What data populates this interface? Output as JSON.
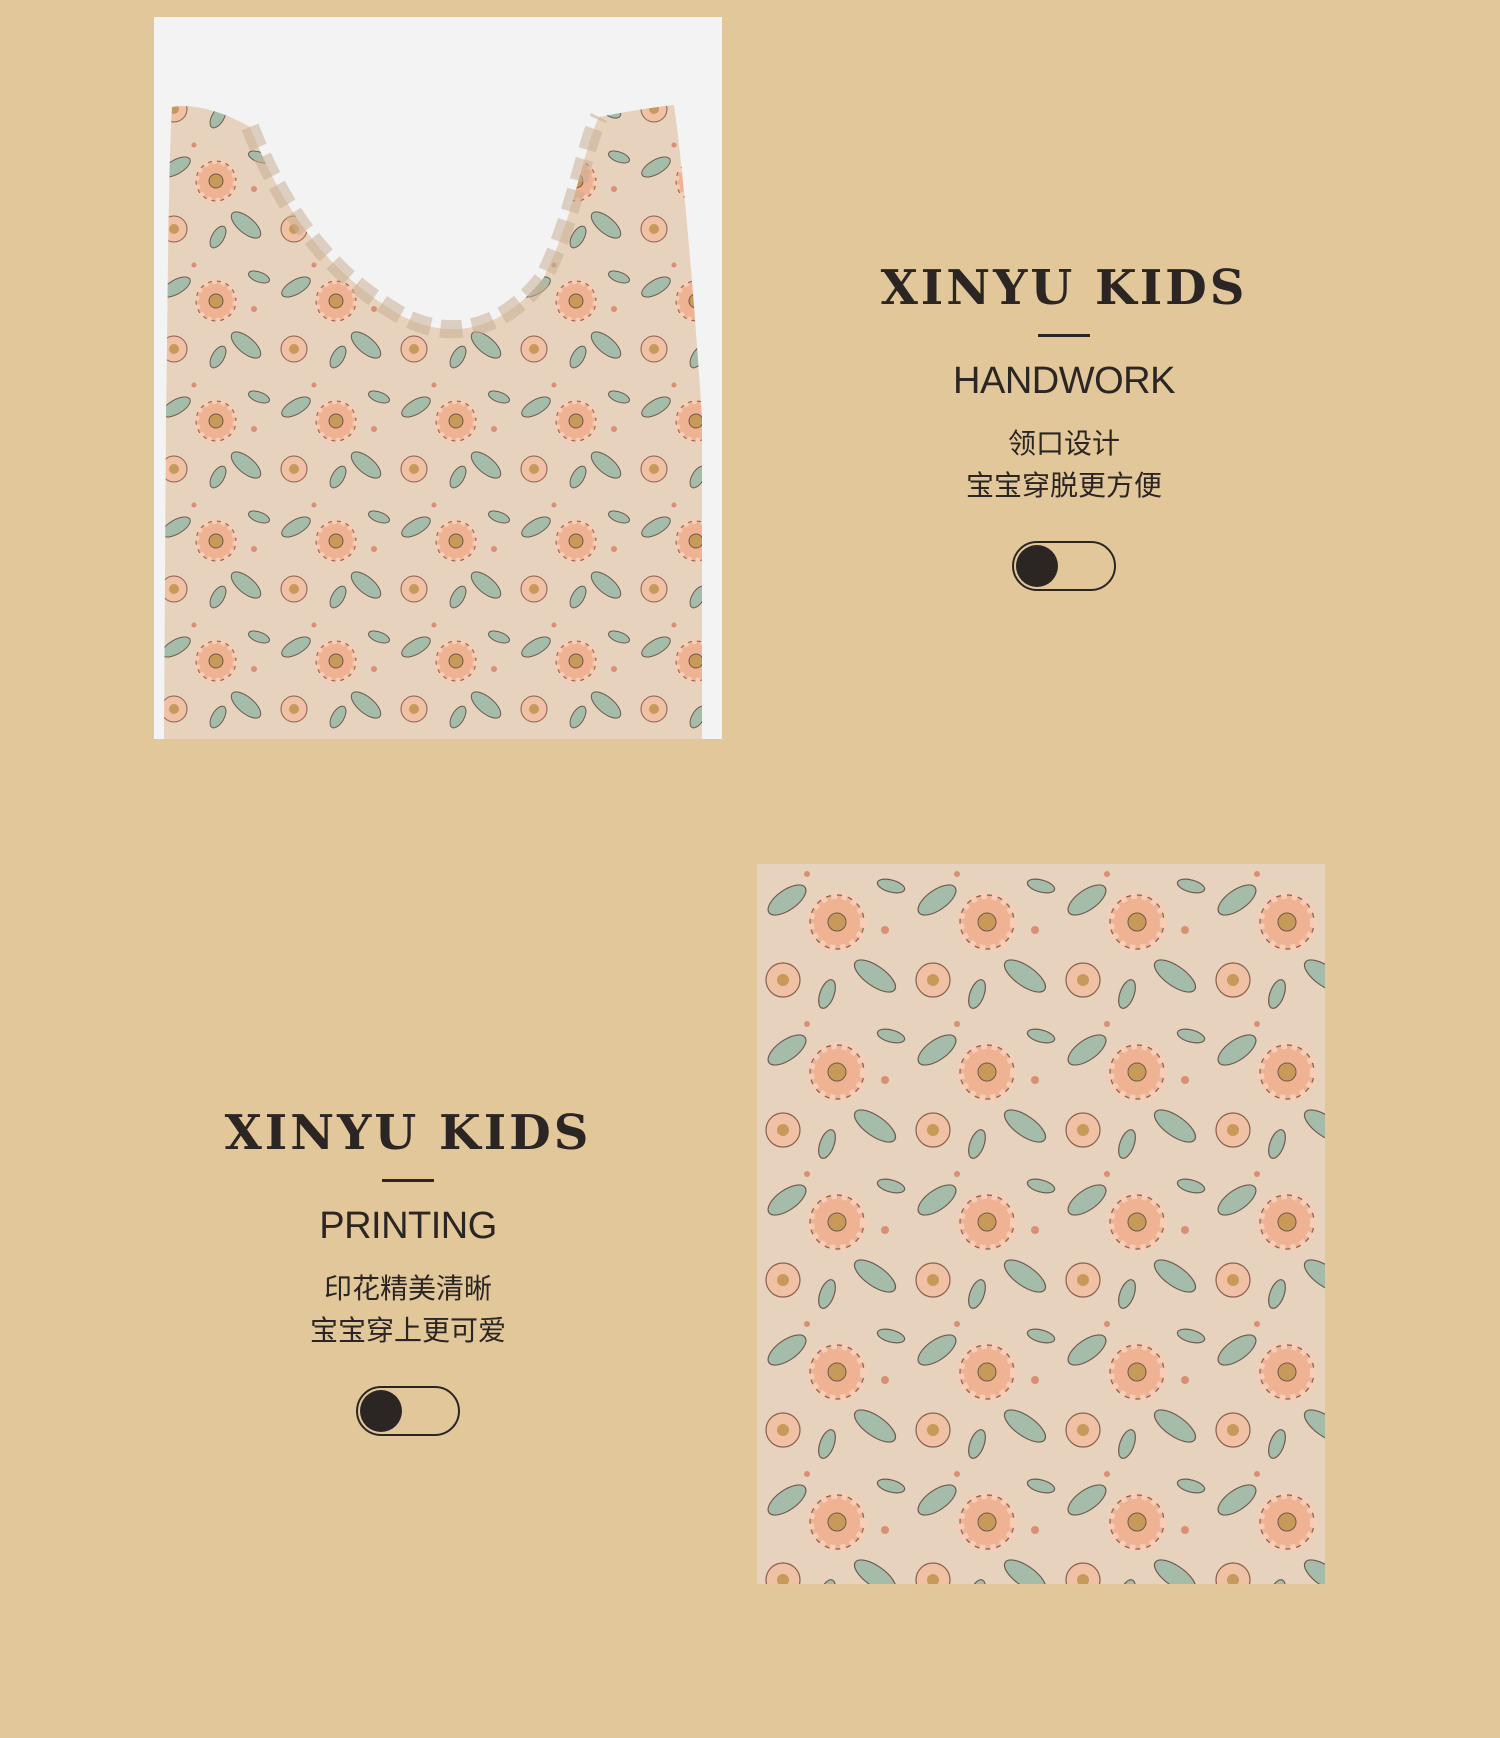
{
  "colors": {
    "background": "#e2c79b",
    "ink": "#2b2623",
    "fabric": "#e6d2bd",
    "flower_peach": "#efb292",
    "leaf_green": "#a6bcaa"
  },
  "sections": [
    {
      "brand": "XINYU KIDS",
      "title": "HANDWORK",
      "desc_line1": "领口设计",
      "desc_line2": "宝宝穿脱更方便",
      "toggle_state": "off"
    },
    {
      "brand": "XINYU KIDS",
      "title": "PRINTING",
      "desc_line1": "印花精美清晰",
      "desc_line2": "宝宝穿上更可爱",
      "toggle_state": "off"
    }
  ],
  "images": {
    "top": "ruffle-collar-floral-swimsuit-photo",
    "bottom": "floral-print-fabric-closeup-photo"
  }
}
